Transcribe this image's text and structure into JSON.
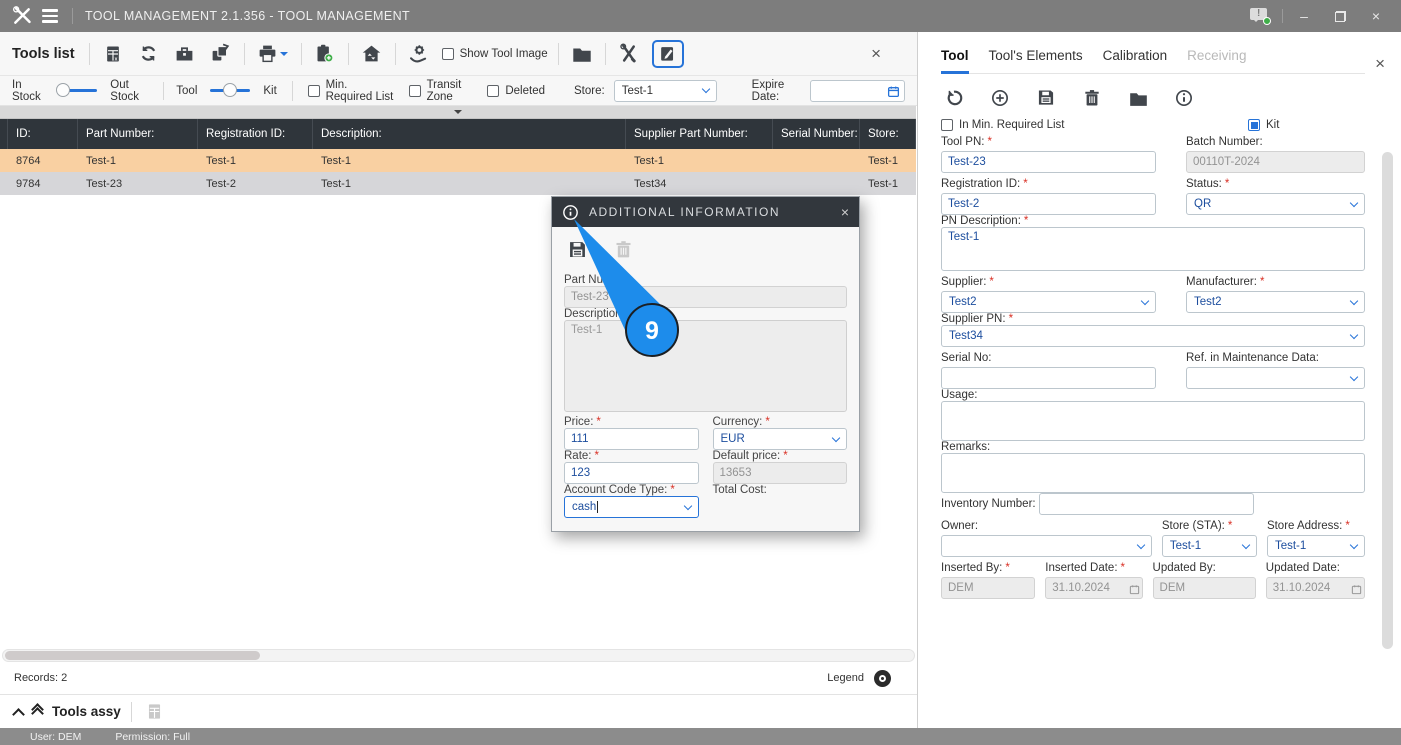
{
  "colors": {
    "accent": "#2673d8",
    "row_highlight": "#f9d0a2",
    "row_selected": "#d6d6d9",
    "table_header_bg": "#2f353b",
    "required_marker": "#d93025",
    "titlebar_bg": "#7d7d7d"
  },
  "ui": {
    "req": "*"
  },
  "icons": [
    "app-logo-tools",
    "menu",
    "report",
    "refresh",
    "toolbox",
    "copy-move",
    "print",
    "clipboard-add",
    "home-transfer",
    "hand-gear",
    "folder",
    "tools",
    "edit",
    "save",
    "delete",
    "undo",
    "add",
    "info",
    "calendar",
    "message",
    "minimize",
    "restore",
    "close",
    "legend-target",
    "collapse-arrow",
    "chevron-up",
    "double-chevron-up"
  ],
  "window": {
    "title": "TOOL MANAGEMENT 2.1.356 - TOOL MANAGEMENT",
    "minimize": "–",
    "close": "×",
    "status_user": "User: DEM",
    "status_permission": "Permission: Full"
  },
  "tools_list": {
    "title": "Tools list",
    "close": "×",
    "show_tool_image": "Show Tool Image",
    "filters": {
      "in_stock": "In Stock",
      "out_stock": "Out Stock",
      "tool": "Tool",
      "kit": "Kit",
      "min_required": "Min. Required List",
      "transit_zone": "Transit Zone",
      "deleted": "Deleted",
      "store_label": "Store:",
      "store_value": "Test-1",
      "expire_label": "Expire Date:",
      "expire_value": ""
    },
    "table": {
      "columns": [
        "ID:",
        "Part Number:",
        "Registration ID:",
        "Description:",
        "Supplier Part Number:",
        "Serial Number:",
        "Store:"
      ],
      "rows": [
        {
          "id": "8764",
          "part_number": "Test-1",
          "registration_id": "Test-1",
          "description": "Test-1",
          "supplier_pn": "Test-1",
          "serial": "",
          "store": "Test-1"
        },
        {
          "id": "9784",
          "part_number": "Test-23",
          "registration_id": "Test-2",
          "description": "Test-1",
          "supplier_pn": "Test34",
          "serial": "",
          "store": "Test-1"
        }
      ]
    },
    "records": "Records: 2",
    "legend": "Legend",
    "assy_title": "Tools assy"
  },
  "dialog": {
    "title": "ADDITIONAL INFORMATION",
    "close": "×",
    "part_number_label": "Part Number:",
    "part_number_value": "Test-23",
    "description_label": "Description:",
    "description_value": "Test-1",
    "price_label": "Price:",
    "price_value": "111",
    "currency_label": "Currency:",
    "currency_value": "EUR",
    "rate_label": "Rate:",
    "rate_value": "123",
    "default_price_label": "Default price:",
    "default_price_value": "13653",
    "account_code_label": "Account Code Type:",
    "account_code_value": "cash",
    "total_cost_label": "Total Cost:",
    "step_number": "9"
  },
  "tool_panel": {
    "close": "×",
    "tabs": [
      {
        "label": "Tool"
      },
      {
        "label": "Tool's Elements"
      },
      {
        "label": "Calibration"
      },
      {
        "label": "Receiving"
      }
    ],
    "in_min_required_label": "In Min. Required List",
    "kit_label": "Kit",
    "tool_pn_label": "Tool PN:",
    "tool_pn_value": "Test-23",
    "batch_label": "Batch Number:",
    "batch_value": "00110T-2024",
    "registration_label": "Registration ID:",
    "registration_value": "Test-2",
    "status_label": "Status:",
    "status_value": "QR",
    "pn_desc_label": "PN Description:",
    "pn_desc_value": "Test-1",
    "supplier_label": "Supplier:",
    "supplier_value": "Test2",
    "manufacturer_label": "Manufacturer:",
    "manufacturer_value": "Test2",
    "supplier_pn_label": "Supplier PN:",
    "supplier_pn_value": "Test34",
    "serial_label": "Serial No:",
    "serial_value": "",
    "ref_label": "Ref. in Maintenance Data:",
    "ref_value": "",
    "usage_label": "Usage:",
    "usage_value": "",
    "remarks_label": "Remarks:",
    "remarks_value": "",
    "inventory_label": "Inventory Number:",
    "inventory_value": "",
    "owner_label": "Owner:",
    "owner_value": "",
    "store_sta_label": "Store (STA):",
    "store_sta_value": "Test-1",
    "store_address_label": "Store Address:",
    "store_address_value": "Test-1",
    "inserted_by_label": "Inserted By:",
    "inserted_by_value": "DEM",
    "inserted_date_label": "Inserted Date:",
    "inserted_date_value": "31.10.2024",
    "updated_by_label": "Updated By:",
    "updated_by_value": "DEM",
    "updated_date_label": "Updated Date:",
    "updated_date_value": "31.10.2024"
  }
}
